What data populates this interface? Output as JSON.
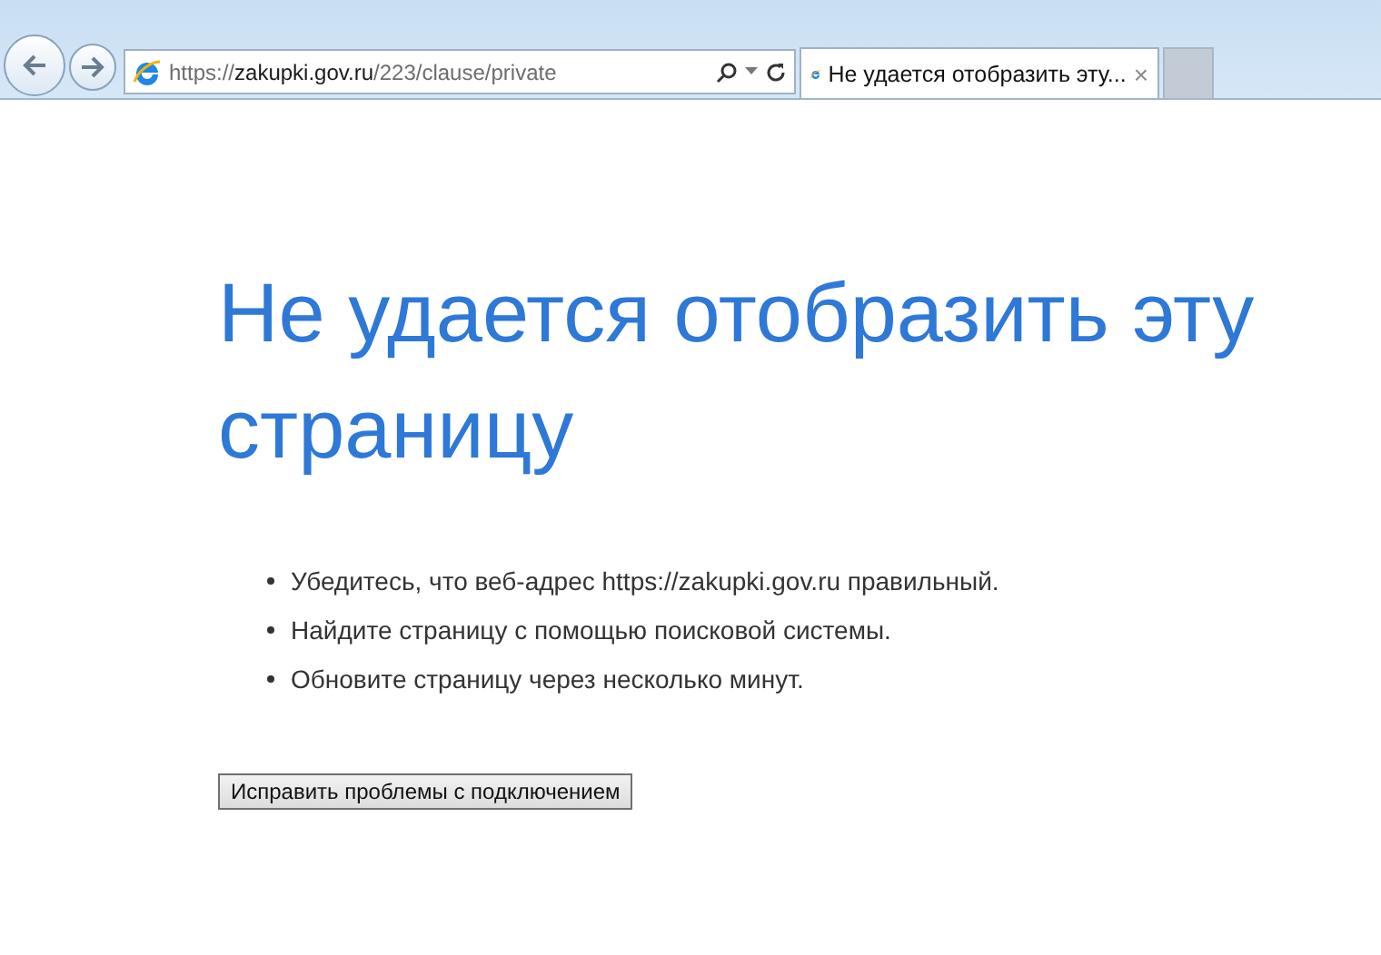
{
  "address_bar": {
    "scheme": "https://",
    "host": "zakupki.gov.ru",
    "path": "/223/clause/private"
  },
  "tabs": [
    {
      "title": "Не удается отобразить эту...",
      "close": "×",
      "selected": true
    }
  ],
  "heading": "Не удается отобразить эту страницу",
  "suggestions": [
    "Убедитесь, что веб-адрес https://zakupki.gov.ru правильный.",
    "Найдите страницу с помощью поисковой системы.",
    "Обновите страницу через несколько минут."
  ],
  "button": "Исправить проблемы с подключением"
}
